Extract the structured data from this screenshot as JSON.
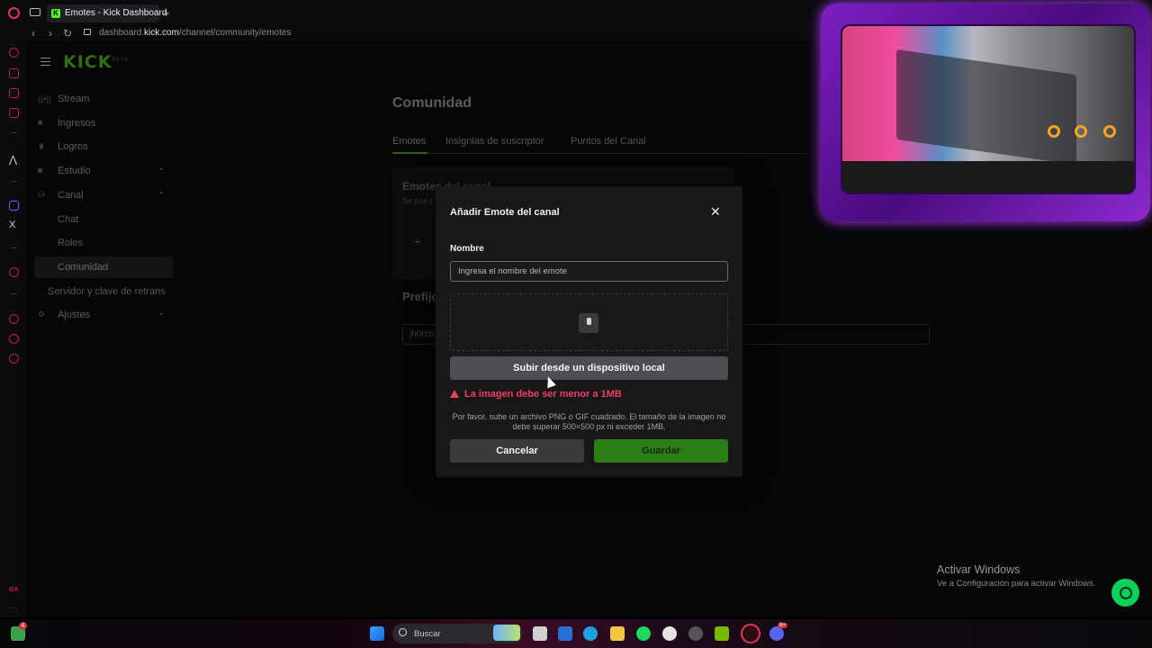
{
  "browser": {
    "tab_title": "Emotes - Kick Dashboard",
    "tab_favicon": "K",
    "url_host": "dashboard.",
    "url_domain": "kick.com",
    "url_path": "/channel/community/emotes",
    "new_tab": "+",
    "close_tab": "×",
    "back": "‹",
    "forward": "›",
    "reload": "↻"
  },
  "sidebar": {
    "logo": "KICK",
    "logo_badge": "BETA",
    "items": [
      {
        "label": "Stream",
        "icon": "broadcast-icon",
        "glyph": "((•))"
      },
      {
        "label": "Ingresos",
        "icon": "revenue-icon",
        "glyph": "■"
      },
      {
        "label": "Logros",
        "icon": "trophy-icon",
        "glyph": "♜"
      },
      {
        "label": "Estudio",
        "icon": "studio-icon",
        "glyph": "◙",
        "chevron": "⌄"
      },
      {
        "label": "Canal",
        "icon": "channel-icon",
        "glyph": "⛁",
        "chevron": "⌃"
      }
    ],
    "sub_items": [
      "Chat",
      "Roles",
      "Comunidad"
    ],
    "extra_item": "Servidor y clave de retrans",
    "settings": {
      "label": "Ajustes",
      "icon": "gear-icon",
      "glyph": "⚙",
      "chevron": "⌄"
    }
  },
  "page": {
    "title": "Comunidad",
    "tabs": [
      "Emotes",
      "Insignias de suscriptor",
      "Puntos del Canal"
    ],
    "card_title": "Emotes del canal",
    "card_sub": "Se pued",
    "prefix_title": "Prefijo",
    "prefix_value": "jh0rch"
  },
  "modal": {
    "title": "Añadir Emote del canal",
    "close": "✕",
    "field_label": "Nombre",
    "name_placeholder": "Ingresa el nombre del emote",
    "upload_label": "Subir desde un dispositivo local",
    "error": "La imagen debe ser menor a 1MB",
    "help": "Por favor, sube un archivo PNG o GIF cuadrado. El tamaño de la imagen no debe superar 500×500 px ni exceder 1MB.",
    "cancel": "Cancelar",
    "save": "Guardar"
  },
  "watermark": {
    "title": "Activar Windows",
    "subtitle": "Ve a Configuración para activar Windows."
  },
  "taskbar": {
    "search_placeholder": "Buscar",
    "badge_count": "4",
    "discord_badge": "9+"
  },
  "opera": {
    "gx_label": "GX",
    "more": "···"
  },
  "colors": {
    "accent_green": "#53fc18",
    "save_green": "#2b7d18",
    "error_red": "#ee3f5f",
    "opera_red": "#c2223a",
    "cam_purple": "#7d1fc4"
  }
}
